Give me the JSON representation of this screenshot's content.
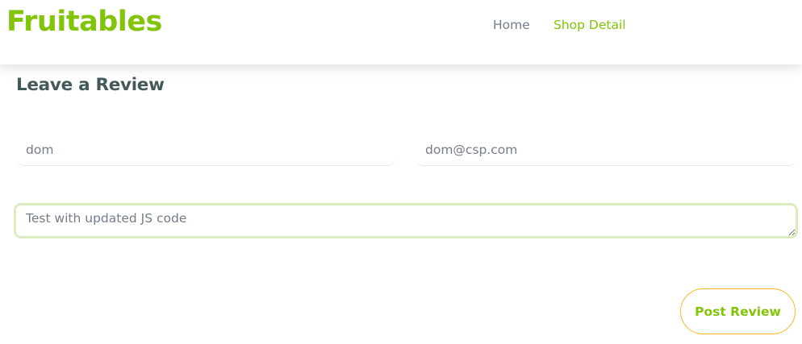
{
  "navbar": {
    "brand": "Fruitables",
    "links": [
      {
        "label": "Home",
        "active": false
      },
      {
        "label": "Shop Detail",
        "active": true
      }
    ]
  },
  "review_form": {
    "title": "Leave a Review",
    "name_value": "dom",
    "email_value": "dom@csp.com",
    "review_value": "Test with updated JS code",
    "submit_label": "Post Review"
  },
  "colors": {
    "brand_green": "#81c408",
    "heading": "#45595b",
    "muted_text": "#747d88",
    "button_border": "#ffb524",
    "focus_ring": "#dbecc0"
  }
}
